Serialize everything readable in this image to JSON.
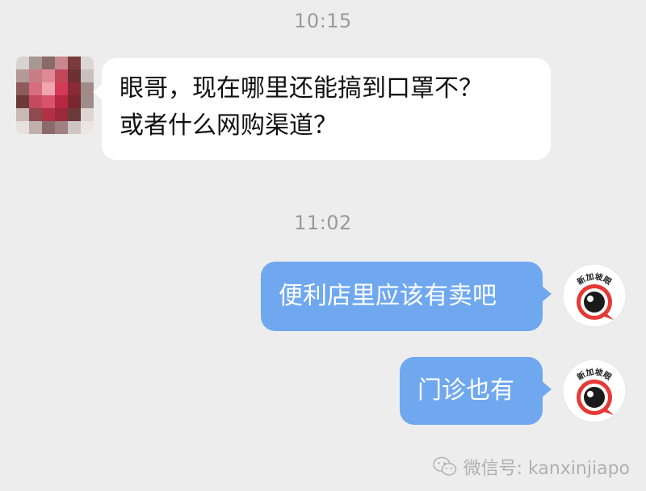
{
  "timestamps": [
    "10:15",
    "11:02"
  ],
  "messages": {
    "incoming": {
      "line1": "眼哥，现在哪里还能搞到口罩不？",
      "line2": "或者什么网购渠道？"
    },
    "outgoing_1": "便利店里应该有卖吧",
    "outgoing_2": "门诊也有"
  },
  "avatar_right": {
    "badge_text": "新加坡眼",
    "icon": "eye-logo-icon"
  },
  "avatar_left": {
    "icon": "pixelated-avatar-icon"
  },
  "watermark": {
    "text": "微信号: kanxinjiapo",
    "icon": "wechat-icon"
  },
  "colors": {
    "background": "#ededed",
    "incoming_bubble": "#ffffff",
    "outgoing_bubble": "#6fa8ef",
    "timestamp": "#9a9a9a",
    "logo_red": "#e53935"
  }
}
